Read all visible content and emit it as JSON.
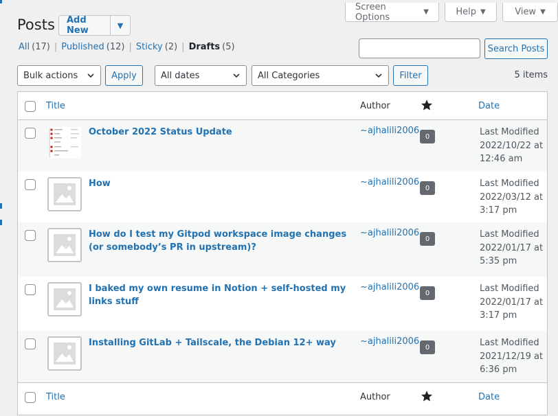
{
  "screen_meta": {
    "screen_options": "Screen Options",
    "help": "Help",
    "view": "View"
  },
  "page": {
    "title": "Posts",
    "add_new": "Add New"
  },
  "views": [
    {
      "label": "All",
      "count": "(17)"
    },
    {
      "label": "Published",
      "count": "(12)"
    },
    {
      "label": "Sticky",
      "count": "(2)"
    },
    {
      "label": "Drafts",
      "count": "(5)",
      "current": true
    }
  ],
  "search": {
    "button": "Search Posts",
    "value": ""
  },
  "filters": {
    "bulk_actions": "Bulk actions",
    "apply": "Apply",
    "dates": "All dates",
    "categories": "All Categories",
    "filter": "Filter",
    "items_count": "5 items"
  },
  "columns": {
    "title": "Title",
    "author": "Author",
    "date": "Date"
  },
  "posts": [
    {
      "title": "October 2022 Status Update",
      "author": "~ajhalili2006",
      "comments": "0",
      "date": [
        "Last Modified",
        "2022/10/22 at",
        "12:46 am"
      ],
      "thumbnail": "image-preview"
    },
    {
      "title": "How",
      "author": "~ajhalili2006",
      "comments": "0",
      "date": [
        "Last Modified",
        "2022/03/12 at",
        "3:17 pm"
      ],
      "thumbnail": "placeholder-image-icon"
    },
    {
      "title": "How do I test my Gitpod workspace image changes (or somebody’s PR in upstream)?",
      "author": "~ajhalili2006",
      "comments": "0",
      "date": [
        "Last Modified",
        "2022/01/17 at",
        "5:35 pm"
      ],
      "thumbnail": "placeholder-image-icon"
    },
    {
      "title": "I baked my own resume in Notion + self-hosted my links stuff",
      "author": "~ajhalili2006",
      "comments": "0",
      "date": [
        "Last Modified",
        "2022/01/17 at",
        "3:17 pm"
      ],
      "thumbnail": "placeholder-image-icon"
    },
    {
      "title": "Installing GitLab + Tailscale, the Debian 12+ way",
      "author": "~ajhalili2006",
      "comments": "0",
      "date": [
        "Last Modified",
        "2021/12/19 at",
        "6:36 pm"
      ],
      "thumbnail": "placeholder-image-icon"
    }
  ],
  "colors": {
    "link": "#2271b1",
    "badge": "#646970",
    "background": "#f0f0f1"
  }
}
